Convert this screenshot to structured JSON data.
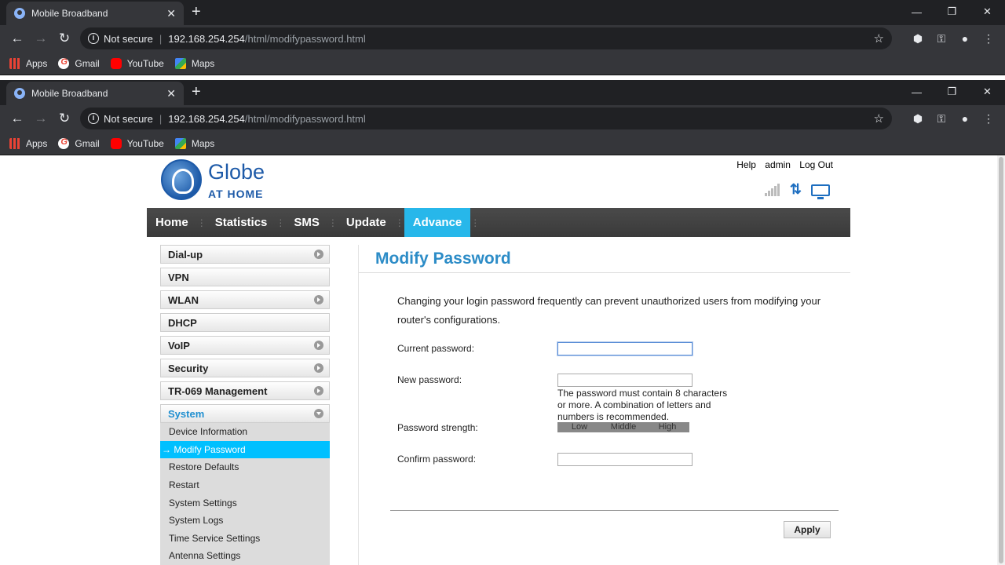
{
  "browser": {
    "tab_title": "Mobile Broadband",
    "tab_close": "✕",
    "new_tab": "+",
    "not_secure": "Not secure",
    "url_host": "192.168.254.254",
    "url_path": "/html/modifypassword.html",
    "bookmarks": [
      "Apps",
      "Gmail",
      "YouTube",
      "Maps"
    ]
  },
  "header": {
    "brand_line1": "Globe",
    "brand_line2": "AT HOME",
    "links": [
      "Help",
      "admin",
      "Log Out"
    ]
  },
  "nav": {
    "items": [
      "Home",
      "Statistics",
      "SMS",
      "Update",
      "Advance"
    ],
    "active": "Advance"
  },
  "sidebar": {
    "menus": [
      "Dial-up",
      "VPN",
      "WLAN",
      "DHCP",
      "VoIP",
      "Security",
      "TR-069 Management",
      "System"
    ],
    "open_menu": "System",
    "sub_items": [
      "Device Information",
      "Modify Password",
      "Restore Defaults",
      "Restart",
      "System Settings",
      "System Logs",
      "Time Service Settings",
      "Antenna Settings"
    ],
    "active_sub_item": "→ Modify Password"
  },
  "content": {
    "title": "Modify Password",
    "description": "Changing your login password frequently can prevent unauthorized users from modifying your router's configurations.",
    "current_password_label": "Current password:",
    "new_password_label": "New password:",
    "password_hint": "The password must contain 8 characters or more. A combination of letters and numbers is recommended.",
    "strength_label": "Password strength:",
    "strength_levels": [
      "Low",
      "Middle",
      "High"
    ],
    "confirm_password_label": "Confirm password:",
    "apply_label": "Apply"
  }
}
